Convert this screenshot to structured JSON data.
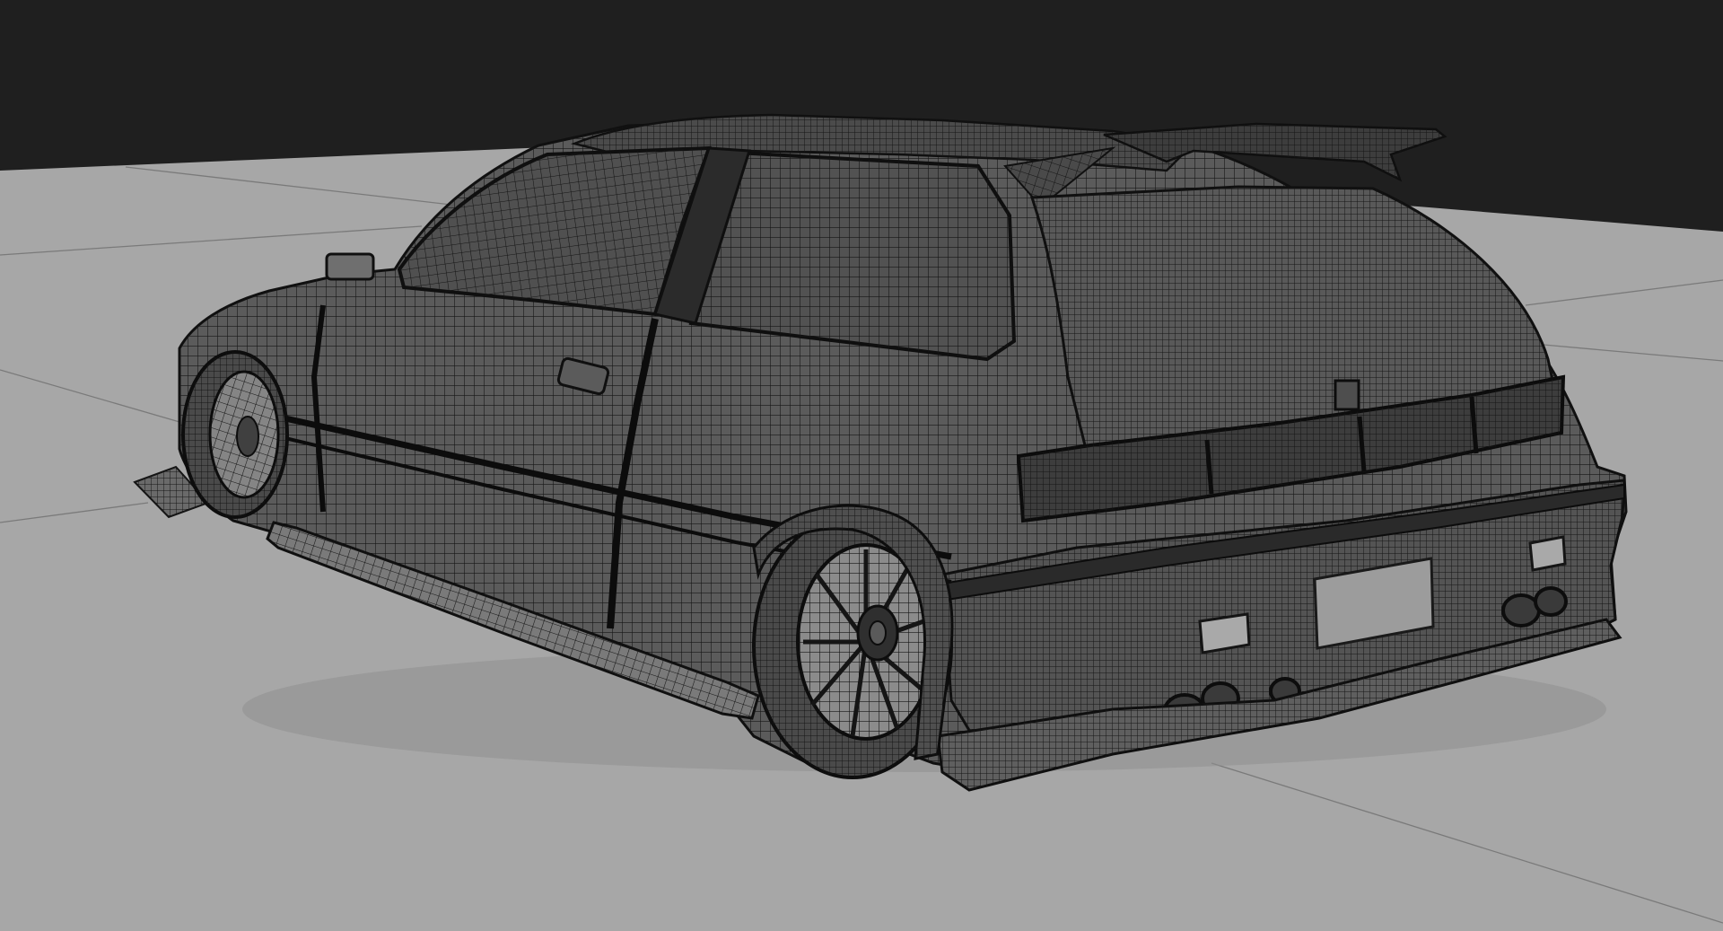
{
  "viewport": {
    "view_mode": "wireframe-on-shaded",
    "subject": "car-model",
    "colors": {
      "background": "#1f1f1f",
      "ground": "#a7a7a7",
      "grid_line": "#7a7a7a",
      "body": "#5b5b5b",
      "body_dark": "#2e2e2e",
      "glass": "#515151",
      "wire": "#151515",
      "tire": "#4a4a4a",
      "rim": "#8b8b8b",
      "plate": "#9c9c9c",
      "reflector": "#a9a9a9"
    }
  }
}
